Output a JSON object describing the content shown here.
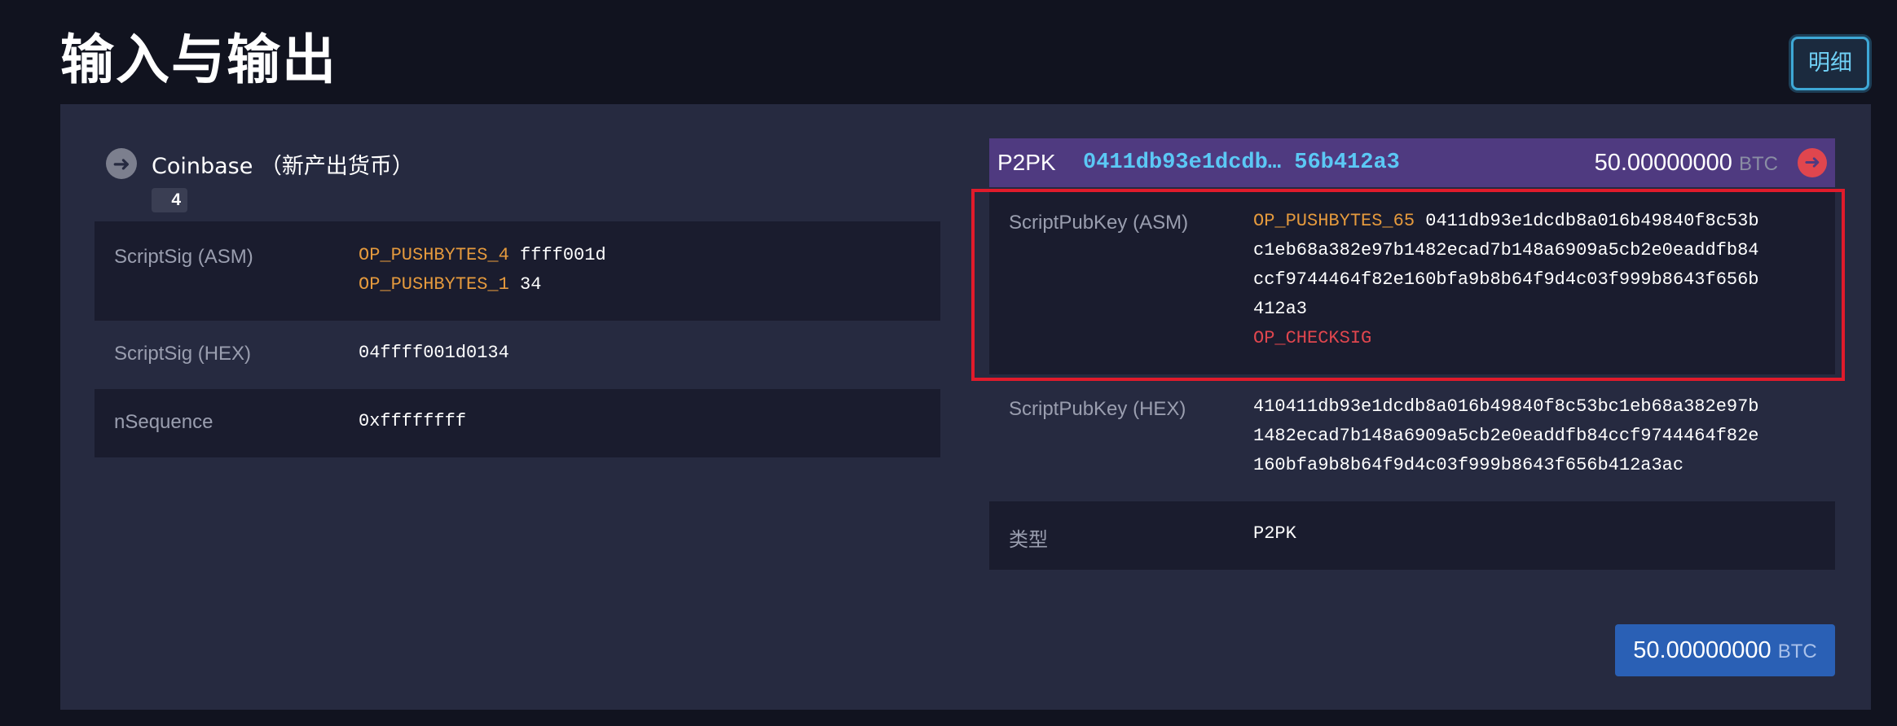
{
  "page": {
    "title": "输入与输出",
    "details_button": "明细"
  },
  "input": {
    "title": "Coinbase （新产出货币）",
    "index_badge": "4",
    "rows": {
      "scriptsig_asm": {
        "label": "ScriptSig (ASM)",
        "line1_op": "OP_PUSHBYTES_4",
        "line1_val": " ffff001d",
        "line2_op": "OP_PUSHBYTES_1",
        "line2_val": " 34"
      },
      "scriptsig_hex": {
        "label": "ScriptSig (HEX)",
        "value": "04ffff001d0134"
      },
      "nsequence": {
        "label": "nSequence",
        "value": "0xffffffff"
      }
    }
  },
  "output": {
    "type": "P2PK",
    "address": "0411db93e1dcdb… 56b412a3",
    "amount": "50.00000000",
    "unit": "BTC",
    "rows": {
      "scriptpubkey_asm": {
        "label": "ScriptPubKey (ASM)",
        "op": "OP_PUSHBYTES_65",
        "line1_rest": " 0411db93e1dcdb8a016b49840f8c53b",
        "line2": "c1eb68a382e97b1482ecad7b148a6909a5cb2e0eaddfb84",
        "line3": "ccf9744464f82e160bfa9b8b64f9d4c03f999b8643f656b",
        "line4": "412a3",
        "op_checksig": "OP_CHECKSIG"
      },
      "scriptpubkey_hex": {
        "label": "ScriptPubKey (HEX)",
        "line1": "410411db93e1dcdb8a016b49840f8c53bc1eb68a382e97b",
        "line2": "1482ecad7b148a6909a5cb2e0eaddfb84ccf9744464f82e",
        "line3": "160bfa9b8b64f9d4c03f999b8643f656b412a3ac"
      },
      "type_row": {
        "label": "类型",
        "value": "P2PK"
      }
    }
  },
  "total": {
    "amount": "50.00000000",
    "unit": "BTC"
  },
  "colors": {
    "background": "#11131f",
    "panel": "#262a40",
    "row_dark": "#1a1c2e",
    "output_header": "#4f3a80",
    "address": "#5bc8f5",
    "opcode": "#e59a3d",
    "opcode_red": "#e0464e",
    "highlight": "#e01b2b",
    "total_button": "#2a60b5"
  }
}
